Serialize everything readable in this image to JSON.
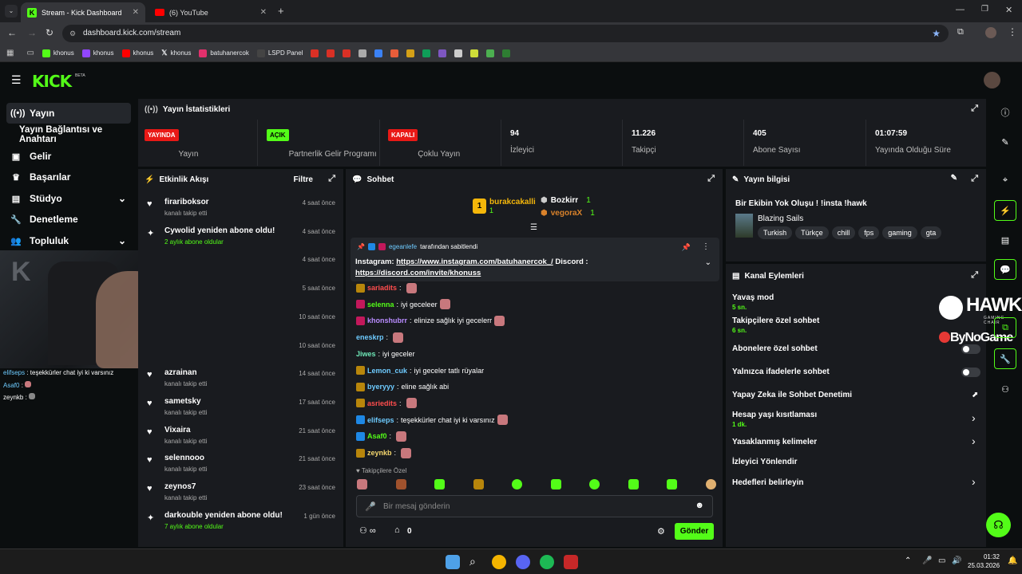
{
  "browser": {
    "tabs": [
      {
        "label": "Stream - Kick Dashboard"
      },
      {
        "label": "(6) YouTube"
      }
    ],
    "url": "dashboard.kick.com/stream",
    "bookmarks": [
      "khonus",
      "khonus",
      "khonus",
      "khonus",
      "batuhanercok",
      "LSPD Panel"
    ]
  },
  "kick": {
    "logo": "KICK",
    "beta": "BETA"
  },
  "sidebar": {
    "items": [
      {
        "label": "Yayın"
      },
      {
        "label": "Yayın Bağlantısı ve Anahtarı"
      },
      {
        "label": "Gelir"
      },
      {
        "label": "Başarılar"
      },
      {
        "label": "Stüdyo"
      },
      {
        "label": "Denetleme"
      },
      {
        "label": "Topluluk"
      }
    ],
    "mini_chat": [
      {
        "user": "elifseps",
        "text": "teşekkürler chat iyi ki varsınız"
      },
      {
        "user": "Asaf0",
        "text": ""
      },
      {
        "user": "zeynkb",
        "text": ""
      }
    ]
  },
  "stats": {
    "title": "Yayın İstatistikleri",
    "items": [
      {
        "value": "YAYINDA",
        "label": "Yayın"
      },
      {
        "value": "AÇIK",
        "label": "Partnerlik Gelir Programı"
      },
      {
        "value": "KAPALI",
        "label": "Çoklu Yayın"
      },
      {
        "value": "94",
        "label": "İzleyici"
      },
      {
        "value": "11.226",
        "label": "Takipçi"
      },
      {
        "value": "405",
        "label": "Abone Sayısı"
      },
      {
        "value": "01:07:59",
        "label": "Yayında Olduğu Süre"
      }
    ]
  },
  "activity": {
    "title": "Etkinlik Akışı",
    "filter": "Filtre",
    "items": [
      {
        "name": "firariboksor",
        "sub": "kanalı takip etti",
        "time": "4 saat önce"
      },
      {
        "name": "Cywolid yeniden abone oldu!",
        "sub": "2 aylık abone oldular",
        "time": "4 saat önce"
      },
      {
        "name": "",
        "sub": "",
        "time": "4 saat önce"
      },
      {
        "name": "",
        "sub": "",
        "time": "5 saat önce"
      },
      {
        "name": "",
        "sub": "",
        "time": "10 saat önce"
      },
      {
        "name": "",
        "sub": "",
        "time": "10 saat önce"
      },
      {
        "name": "azrainan",
        "sub": "kanalı takip etti",
        "time": "14 saat önce"
      },
      {
        "name": "sametsky",
        "sub": "kanalı takip etti",
        "time": "17 saat önce"
      },
      {
        "name": "Vixaira",
        "sub": "kanalı takip etti",
        "time": "21 saat önce"
      },
      {
        "name": "selennooo",
        "sub": "kanalı takip etti",
        "time": "21 saat önce"
      },
      {
        "name": "zeynos7",
        "sub": "kanalı takip etti",
        "time": "23 saat önce"
      },
      {
        "name": "darkouble yeniden abone oldu!",
        "sub": "7 aylık abone oldular",
        "time": "1 gün önce"
      }
    ]
  },
  "chat": {
    "title": "Sohbet",
    "top": [
      {
        "name": "burakcakalli",
        "count": "1"
      },
      {
        "name": "Bozkirr",
        "count": "1"
      },
      {
        "name": "vegoraX",
        "count": "1"
      }
    ],
    "pinned": {
      "by": "egeanlefe",
      "by_suffix": "tarafından sabitlendi",
      "text": "Instagram: ",
      "link1": "https://www.instagram.com/batuhanercok_/",
      "mid": " Discord : ",
      "link2": "https://discord.com/invite/khonuss"
    },
    "messages": [
      {
        "user": "sariadits",
        "text": "",
        "color": "#ff4d4d"
      },
      {
        "user": "selenna",
        "text": "iyi geceleer",
        "color": "#53fc18"
      },
      {
        "user": "khonshubrr",
        "text": "elinize sağlık iyi gecelerr",
        "color": "#b98cff"
      },
      {
        "user": "eneskrp",
        "text": "",
        "color": "#6ecbff"
      },
      {
        "user": "Jiwes",
        "text": "iyi geceler",
        "color": "#6ee7b7"
      },
      {
        "user": "Lemon_cuk",
        "text": "iyi geceler tatlı rüyalar",
        "color": "#6ecbff"
      },
      {
        "user": "byeryyy",
        "text": "eline sağlık abi",
        "color": "#6ecbff"
      },
      {
        "user": "asriedits",
        "text": "",
        "color": "#ff4d4d"
      },
      {
        "user": "elifseps",
        "text": "teşekkürler chat iyi ki varsınız",
        "color": "#6ecbff"
      },
      {
        "user": "Asaf0",
        "text": "",
        "color": "#53fc18"
      },
      {
        "user": "zeynkb",
        "text": "",
        "color": "#f5d76e"
      }
    ],
    "followers_only": "Takipçilere Özel",
    "placeholder": "Bir mesaj gönderin",
    "count": "0",
    "send": "Gönder"
  },
  "stream_info": {
    "title": "Yayın bilgisi",
    "stream_title": "Bir Ekibin Yok Oluşu ! !insta !hawk",
    "category": "Blazing Sails",
    "tags": [
      "Turkish",
      "Türkçe",
      "chill",
      "fps",
      "gaming",
      "gta"
    ]
  },
  "channel_actions": {
    "title": "Kanal Eylemleri",
    "items": [
      {
        "label": "Yavaş mod",
        "sub": "5 sn."
      },
      {
        "label": "Takipçilere özel sohbet",
        "sub": "6 sn."
      },
      {
        "label": "Abonelere özel sohbet",
        "sub": ""
      },
      {
        "label": "Yalnızca ifadelerle sohbet",
        "sub": ""
      },
      {
        "label": "Yapay Zeka ile Sohbet Denetimi",
        "sub": ""
      },
      {
        "label": "Hesap yaşı kısıtlaması",
        "sub": "1 dk."
      },
      {
        "label": "Yasaklanmış kelimeler",
        "sub": ""
      },
      {
        "label": "İzleyici Yönlendir",
        "sub": ""
      },
      {
        "label": "Hedefleri belirleyin",
        "sub": ""
      }
    ]
  },
  "overlay": {
    "brand1": "HAWK",
    "brand1_sub": "GAMING CHAIR",
    "brand2": "ByNoGame"
  },
  "taskbar": {
    "time": "01:32",
    "date": "25.03.2026"
  },
  "colors": {
    "accent": "#53fc18",
    "live": "#e91916",
    "panel": "#191b1f"
  }
}
